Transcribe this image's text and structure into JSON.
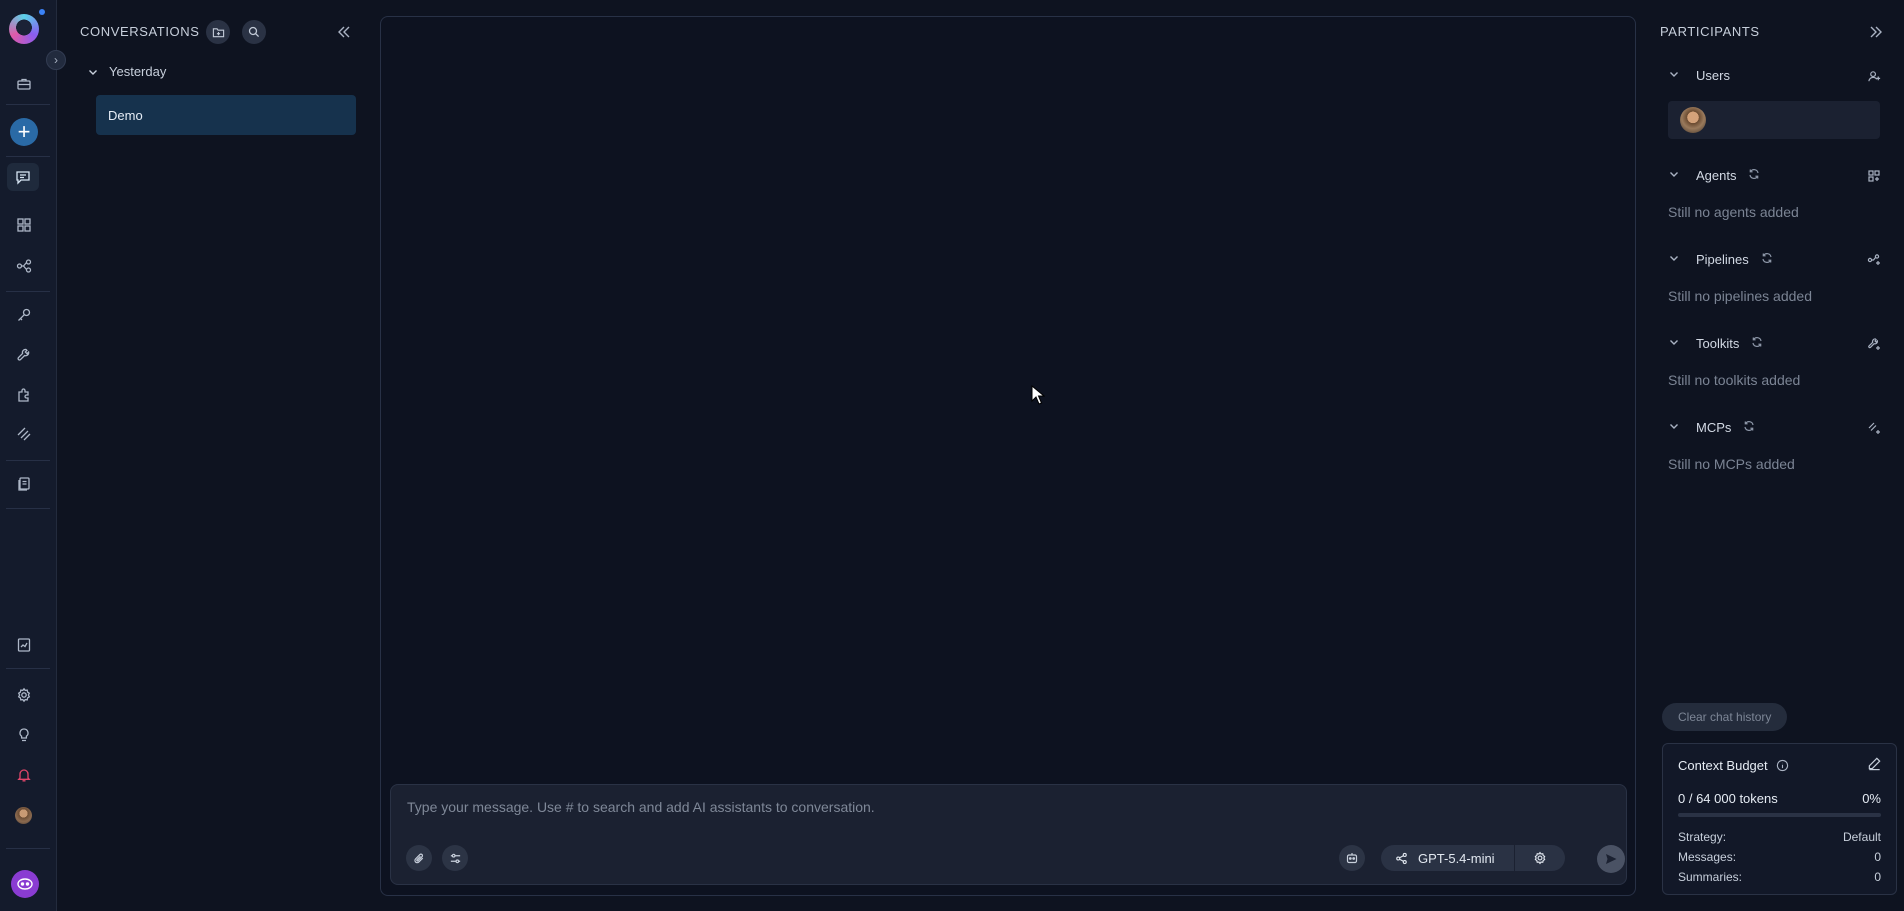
{
  "conversations": {
    "header": "CONVERSATIONS",
    "group_label": "Yesterday",
    "items": [
      {
        "label": "Demo"
      }
    ]
  },
  "composer": {
    "placeholder": "Type your message. Use # to search and add AI assistants to conversation.",
    "model": "GPT-5.4-mini"
  },
  "participants": {
    "header": "PARTICIPANTS",
    "sections": {
      "users": {
        "label": "Users"
      },
      "agents": {
        "label": "Agents",
        "empty": "Still no agents added"
      },
      "pipelines": {
        "label": "Pipelines",
        "empty": "Still no pipelines added"
      },
      "toolkits": {
        "label": "Toolkits",
        "empty": "Still no toolkits added"
      },
      "mcps": {
        "label": "MCPs",
        "empty": "Still no MCPs added"
      }
    },
    "clear_history": "Clear chat history",
    "context_budget": {
      "title": "Context Budget",
      "tokens": "0 / 64 000 tokens",
      "percent": "0%",
      "usage_fraction": 0,
      "strategy_label": "Strategy:",
      "strategy_value": "Default",
      "messages_label": "Messages:",
      "messages_value": "0",
      "summaries_label": "Summaries:",
      "summaries_value": "0"
    }
  },
  "colors": {
    "background": "#0e1320",
    "accent": "#2a6aa6",
    "active_item": "#16324d",
    "assistant_button": "#8a3cd2"
  }
}
